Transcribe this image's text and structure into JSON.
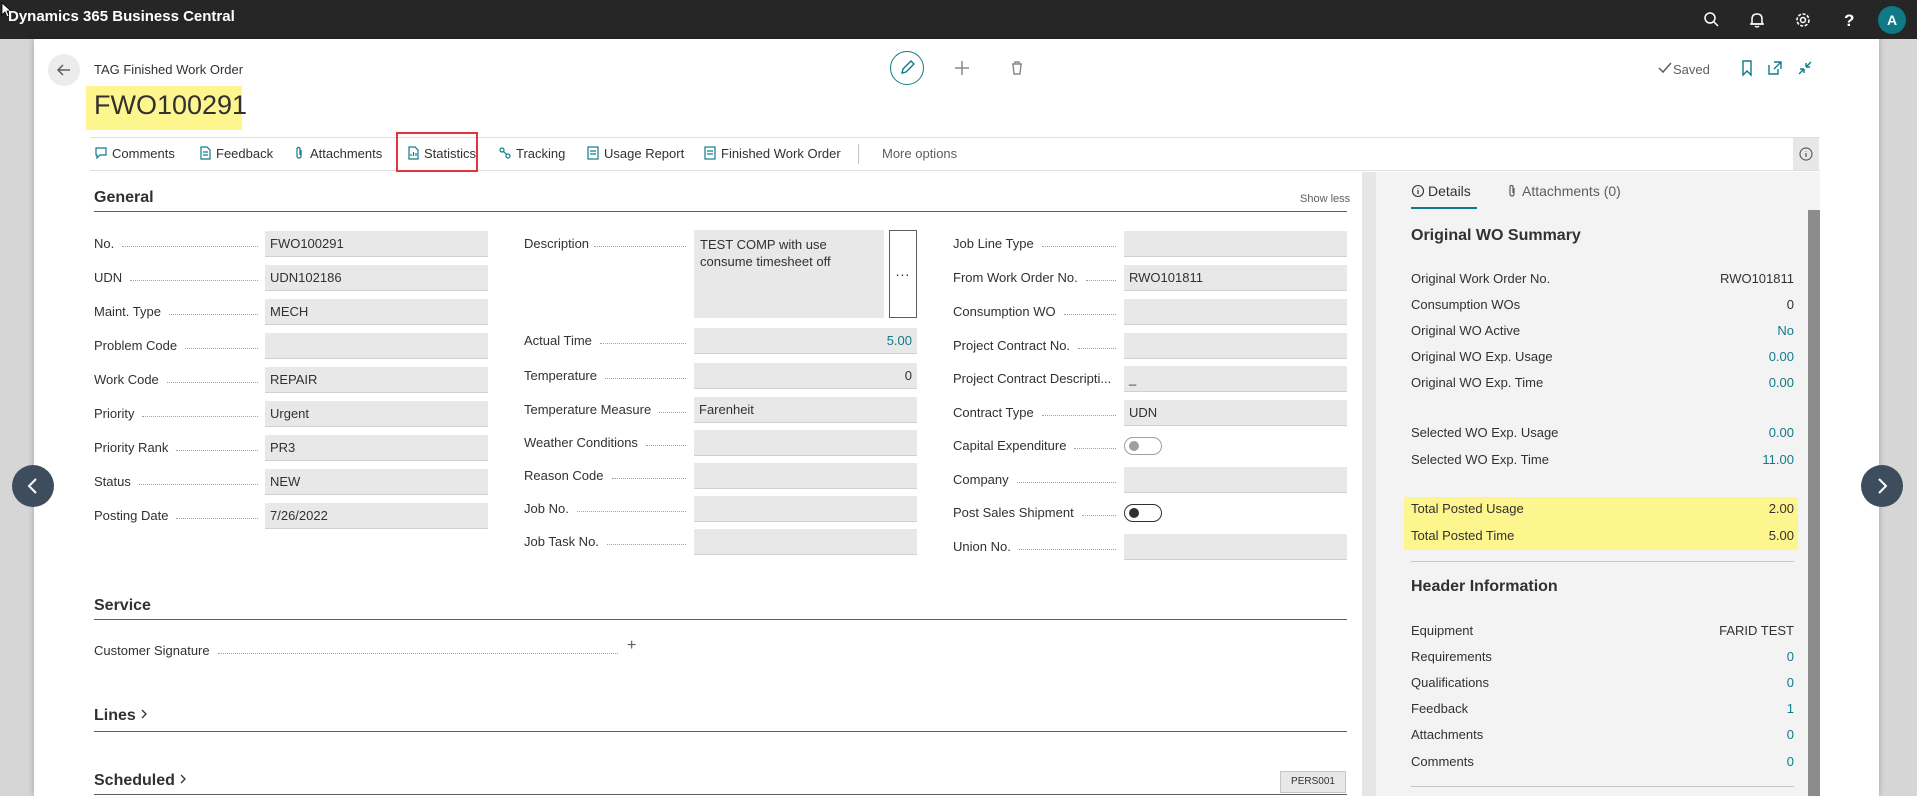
{
  "app": {
    "brand": "Dynamics 365 Business Central",
    "avatar_letter": "A"
  },
  "header": {
    "caption": "TAG Finished Work Order",
    "title": "FWO100291",
    "saved_label": "Saved"
  },
  "actions": {
    "comments": "Comments",
    "feedback": "Feedback",
    "attachments": "Attachments",
    "statistics": "Statistics",
    "tracking": "Tracking",
    "usage_report": "Usage Report",
    "finished_work_order": "Finished Work Order",
    "more_options": "More options"
  },
  "general": {
    "heading": "General",
    "show_less": "Show less",
    "col1": [
      {
        "label": "No.",
        "value": "FWO100291"
      },
      {
        "label": "UDN",
        "value": "UDN102186"
      },
      {
        "label": "Maint. Type",
        "value": "MECH"
      },
      {
        "label": "Problem Code",
        "value": ""
      },
      {
        "label": "Work Code",
        "value": "REPAIR"
      },
      {
        "label": "Priority",
        "value": "Urgent"
      },
      {
        "label": "Priority Rank",
        "value": "PR3"
      },
      {
        "label": "Status",
        "value": "NEW"
      },
      {
        "label": "Posting Date",
        "value": "7/26/2022"
      }
    ],
    "description": {
      "label": "Description",
      "value": "TEST COMP with use consume timesheet off",
      "button": "..."
    },
    "col2": [
      {
        "label": "Actual Time",
        "value": "5.00"
      },
      {
        "label": "Temperature",
        "value": "0"
      },
      {
        "label": "Temperature Measure",
        "value": "Farenheit"
      },
      {
        "label": "Weather Conditions",
        "value": ""
      },
      {
        "label": "Reason Code",
        "value": ""
      },
      {
        "label": "Job No.",
        "value": ""
      },
      {
        "label": "Job Task No.",
        "value": ""
      }
    ],
    "col3": [
      {
        "label": "Job Line Type",
        "value": ""
      },
      {
        "label": "From Work Order No.",
        "value": "RWO101811"
      },
      {
        "label": "Consumption WO",
        "value": ""
      },
      {
        "label": "Project Contract No.",
        "value": ""
      },
      {
        "label": "Project Contract Descripti...",
        "value": "_"
      },
      {
        "label": "Contract Type",
        "value": "UDN"
      },
      {
        "label": "Capital Expenditure",
        "value": ""
      },
      {
        "label": "Company",
        "value": ""
      },
      {
        "label": "Post Sales Shipment",
        "value": ""
      },
      {
        "label": "Union No.",
        "value": ""
      }
    ]
  },
  "service": {
    "heading": "Service",
    "customer_signature": "Customer Signature",
    "plus": "+"
  },
  "lines": {
    "heading": "Lines"
  },
  "scheduled": {
    "heading": "Scheduled",
    "chip": "PERS001"
  },
  "pane": {
    "tab_details": "Details",
    "tab_attachments": "Attachments (0)",
    "summary_heading": "Original WO Summary",
    "summary": [
      {
        "label": "Original Work Order No.",
        "value": "RWO101811"
      },
      {
        "label": "Consumption WOs",
        "value": "0"
      },
      {
        "label": "Original WO Active",
        "value": "No"
      },
      {
        "label": "Original WO Exp. Usage",
        "value": "0.00"
      },
      {
        "label": "Original WO Exp. Time",
        "value": "0.00"
      },
      {
        "label": "Selected WO Exp. Usage",
        "value": "0.00"
      },
      {
        "label": "Selected WO Exp. Time",
        "value": "11.00"
      },
      {
        "label": "Total Posted Usage",
        "value": "2.00"
      },
      {
        "label": "Total Posted Time",
        "value": "5.00"
      }
    ],
    "header_heading": "Header Information",
    "header_info": [
      {
        "label": "Equipment",
        "value": "FARID TEST"
      },
      {
        "label": "Requirements",
        "value": "0"
      },
      {
        "label": "Qualifications",
        "value": "0"
      },
      {
        "label": "Feedback",
        "value": "1"
      },
      {
        "label": "Attachments",
        "value": "0"
      },
      {
        "label": "Comments",
        "value": "0"
      }
    ]
  },
  "colors": {
    "accent": "#0f7b8a",
    "highlight": "#fdf58e",
    "appbar": "#262626",
    "statistics_outline": "#e0363b"
  }
}
